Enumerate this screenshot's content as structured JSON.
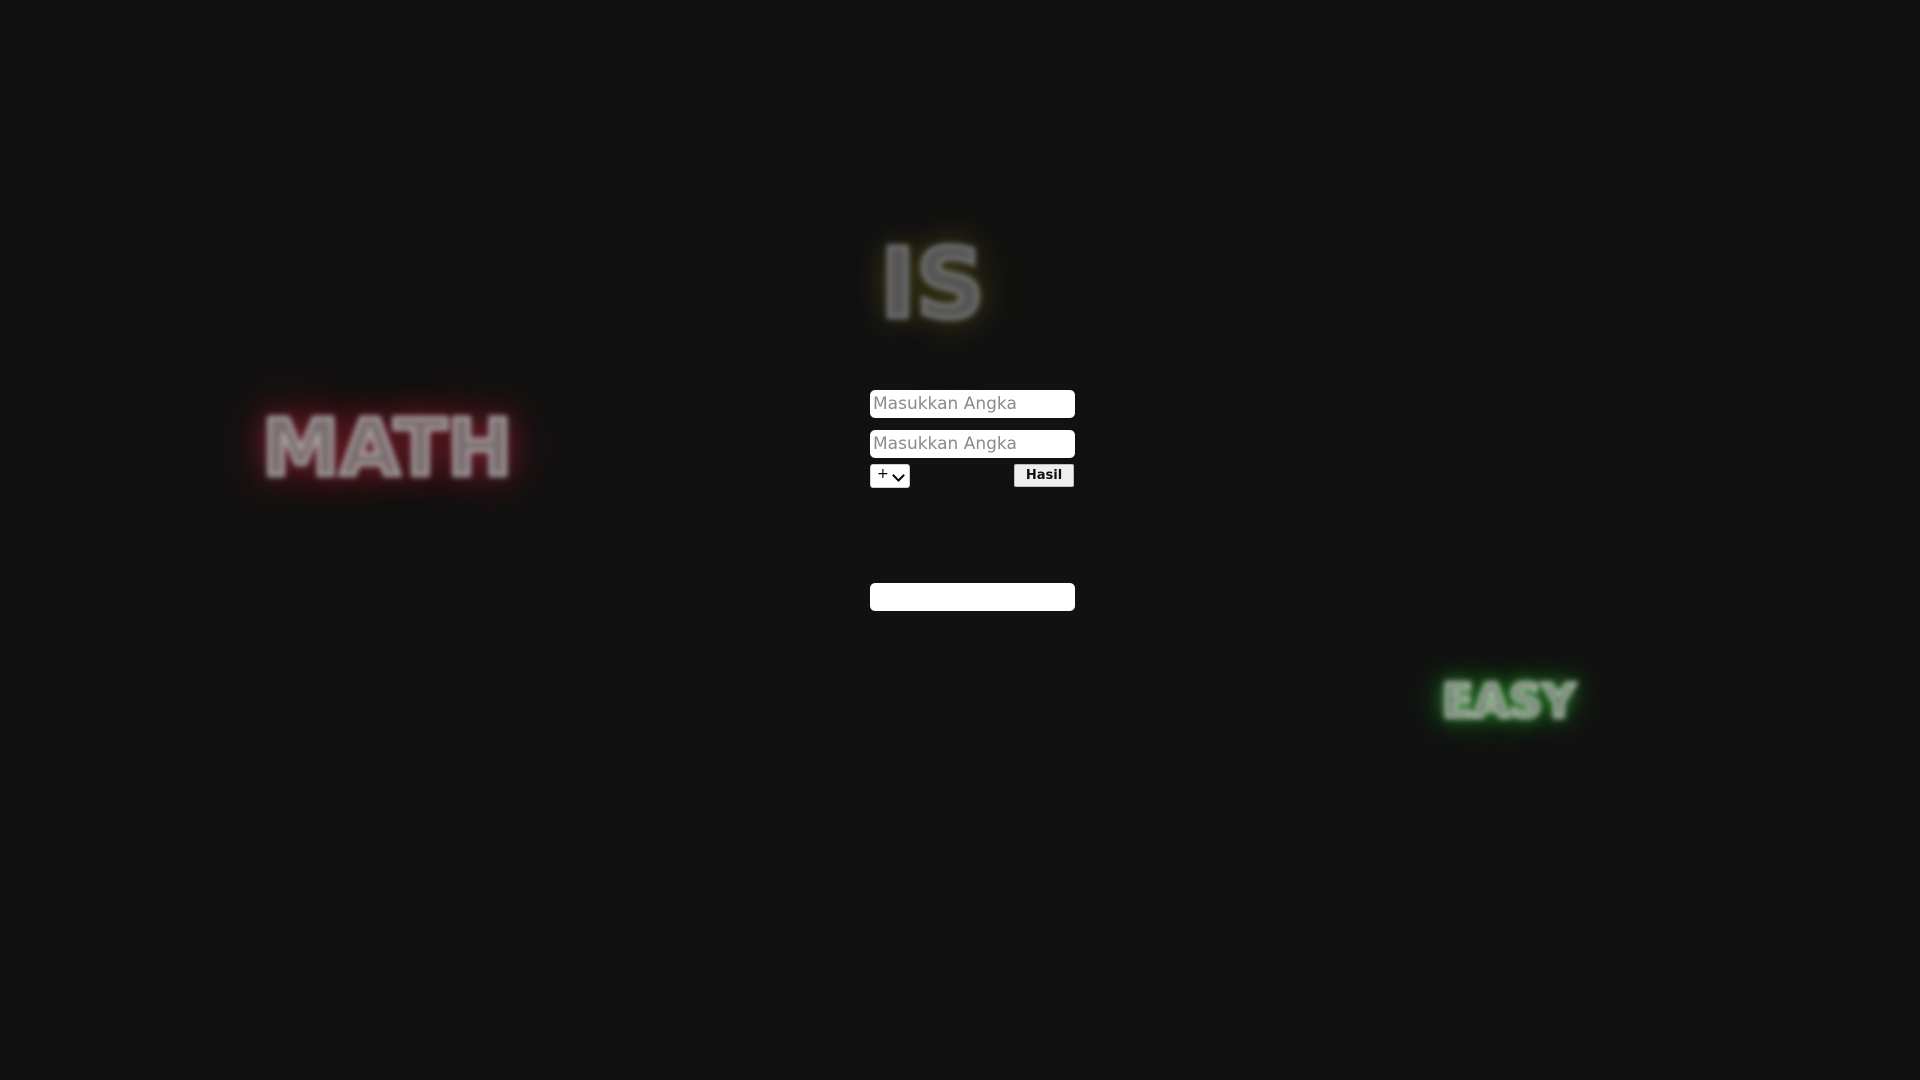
{
  "background": {
    "color": "#111111",
    "words": [
      {
        "text": "MATH",
        "glow_color": "#aa283c"
      },
      {
        "text": "IS",
        "glow_color": "#786e1e"
      },
      {
        "text": "EASY",
        "glow_color": "#3cc83c"
      }
    ]
  },
  "calculator": {
    "input_a": {
      "placeholder": "Masukkan Angka",
      "value": ""
    },
    "input_b": {
      "placeholder": "Masukkan Angka",
      "value": ""
    },
    "operator": {
      "selected": "+"
    },
    "submit_label": "Hasil",
    "result": {
      "value": ""
    }
  }
}
